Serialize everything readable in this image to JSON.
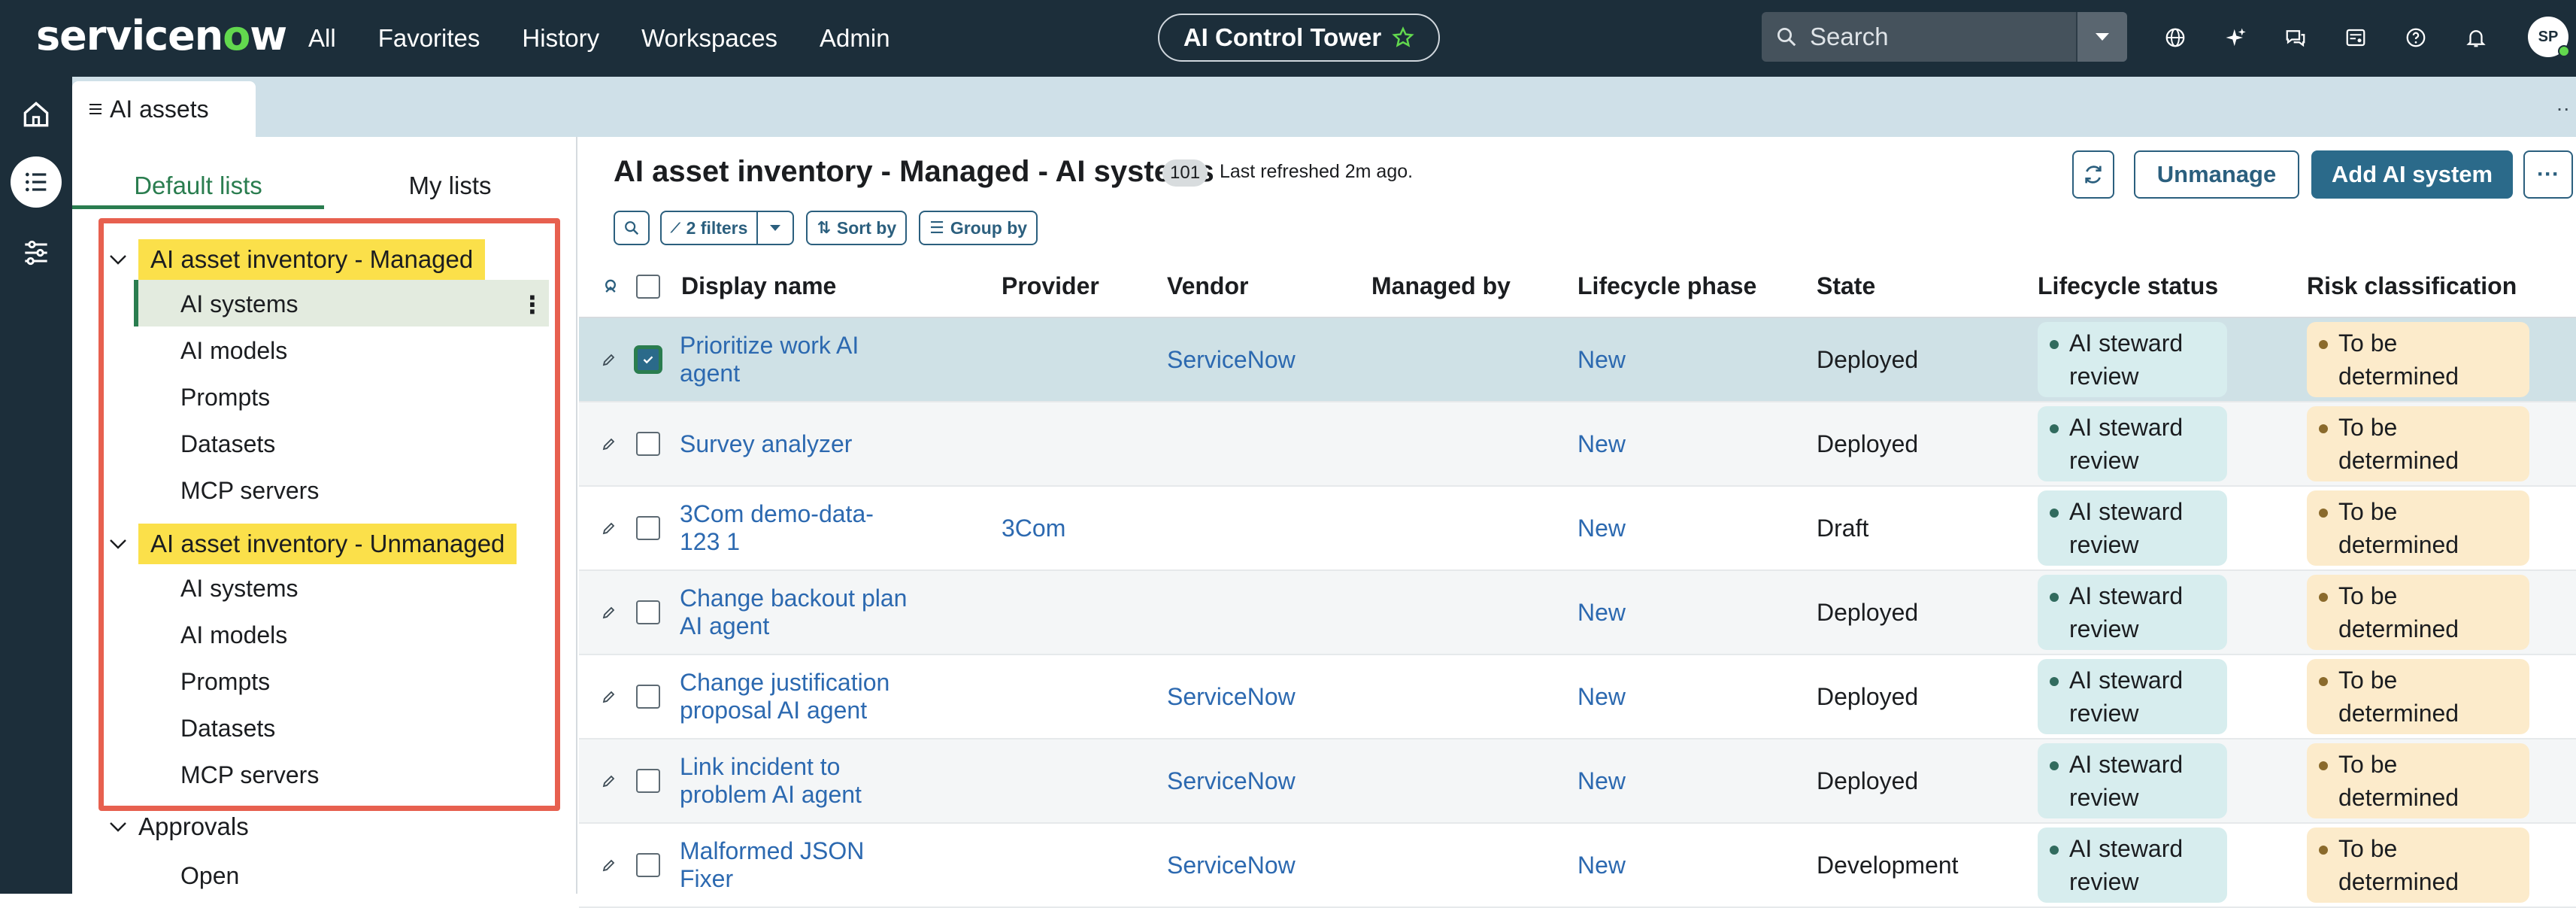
{
  "header": {
    "logo_pre": "servicen",
    "logo_o": "o",
    "logo_post": "w",
    "nav": [
      "All",
      "Favorites",
      "History",
      "Workspaces",
      "Admin"
    ],
    "workspace_pill": "AI Control Tower",
    "search_placeholder": "Search",
    "avatar_initials": "SP"
  },
  "tab": {
    "label": "AI assets"
  },
  "sidebar": {
    "tabs": [
      "Default lists",
      "My lists"
    ],
    "group_managed": "AI asset inventory - Managed",
    "managed_items": [
      "AI systems",
      "AI models",
      "Prompts",
      "Datasets",
      "MCP servers"
    ],
    "group_unmanaged": "AI asset inventory - Unmanaged",
    "unmanaged_items": [
      "AI systems",
      "AI models",
      "Prompts",
      "Datasets",
      "MCP servers"
    ],
    "group_approvals": "Approvals",
    "approvals_items": [
      "Open"
    ]
  },
  "main": {
    "title": "AI asset inventory - Managed - AI systems",
    "count": "101",
    "refreshed": "Last refreshed 2m ago.",
    "unmanage_label": "Unmanage",
    "add_label": "Add AI system",
    "filters_label": "2 filters",
    "sort_label": "Sort by",
    "group_label": "Group by"
  },
  "table": {
    "columns": [
      "Display name",
      "Provider",
      "Vendor",
      "Managed by",
      "Lifecycle phase",
      "State",
      "Lifecycle status",
      "Risk classification"
    ],
    "rows": [
      {
        "name": "Prioritize work AI agent",
        "provider": "",
        "vendor": "ServiceNow",
        "managed_by": "",
        "phase": "New",
        "state": "Deployed",
        "status": "AI steward review",
        "risk": "To be determined",
        "checked": true
      },
      {
        "name": "Survey analyzer",
        "provider": "",
        "vendor": "",
        "managed_by": "",
        "phase": "New",
        "state": "Deployed",
        "status": "AI steward review",
        "risk": "To be determined",
        "checked": false
      },
      {
        "name": "3Com demo-data-123 1",
        "provider": "3Com",
        "vendor": "",
        "managed_by": "",
        "phase": "New",
        "state": "Draft",
        "status": "AI steward review",
        "risk": "To be determined",
        "checked": false
      },
      {
        "name": "Change backout plan AI agent",
        "provider": "",
        "vendor": "",
        "managed_by": "",
        "phase": "New",
        "state": "Deployed",
        "status": "AI steward review",
        "risk": "To be determined",
        "checked": false
      },
      {
        "name": "Change justification proposal AI agent",
        "provider": "",
        "vendor": "ServiceNow",
        "managed_by": "",
        "phase": "New",
        "state": "Deployed",
        "status": "AI steward review",
        "risk": "To be determined",
        "checked": false
      },
      {
        "name": "Link incident to problem AI agent",
        "provider": "",
        "vendor": "ServiceNow",
        "managed_by": "",
        "phase": "New",
        "state": "Deployed",
        "status": "AI steward review",
        "risk": "To be determined",
        "checked": false
      },
      {
        "name": "Malformed JSON Fixer",
        "provider": "",
        "vendor": "ServiceNow",
        "managed_by": "",
        "phase": "New",
        "state": "Development",
        "status": "AI steward review",
        "risk": "To be determined",
        "checked": false
      }
    ]
  },
  "colors": {
    "topbar": "#1c2e3a",
    "accent_green": "#2a7d4f",
    "link": "#2c69b0",
    "primary_button": "#2b6a8a",
    "highlight": "#fbe04a",
    "annotation_box": "#e7604f"
  }
}
